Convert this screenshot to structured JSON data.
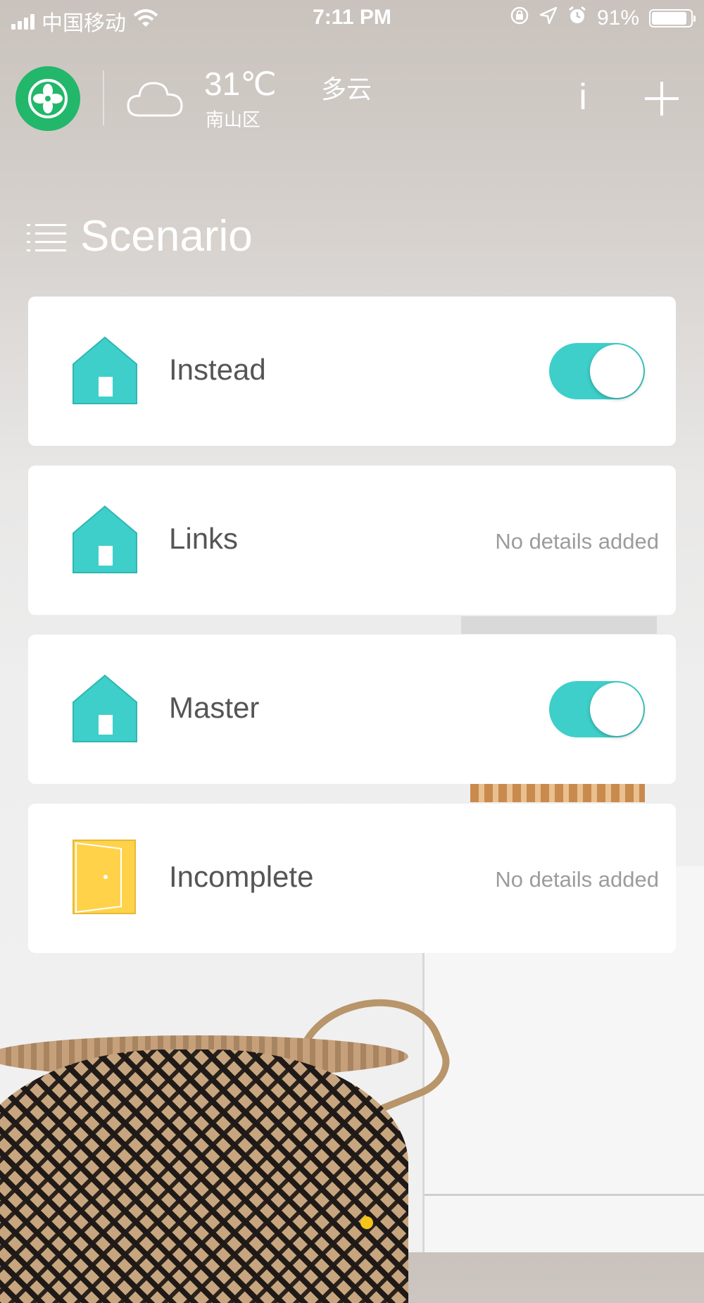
{
  "status_bar": {
    "carrier": "中国移动",
    "time": "7:11 PM",
    "battery_percent": "91%",
    "battery_level": 0.91,
    "icons": [
      "signal-icon",
      "wifi-icon",
      "rotation-lock-icon",
      "location-icon",
      "alarm-icon",
      "battery-icon"
    ]
  },
  "header": {
    "logo_icon": "fan-icon",
    "weather_icon": "cloud-icon",
    "temperature": "31℃",
    "district": "南山区",
    "condition": "多云",
    "info_label": "i",
    "add_icon": "plus-icon"
  },
  "page": {
    "menu_icon": "list-menu-icon",
    "title": "Scenario"
  },
  "scenarios": [
    {
      "name": "Instead",
      "icon": "house-icon",
      "toggle_on": true,
      "detail": ""
    },
    {
      "name": "Links",
      "icon": "house-icon",
      "toggle_on": null,
      "detail": "No details added"
    },
    {
      "name": "Master",
      "icon": "house-icon",
      "toggle_on": true,
      "detail": ""
    },
    {
      "name": "Incomplete",
      "icon": "door-icon",
      "toggle_on": null,
      "detail": "No details added"
    }
  ],
  "colors": {
    "accent": "#3ECFCA",
    "logo_green": "#22B76A",
    "door_yellow": "#FFD24A",
    "page_indicator": "#F5C518"
  },
  "pager": {
    "current_page": 1
  }
}
